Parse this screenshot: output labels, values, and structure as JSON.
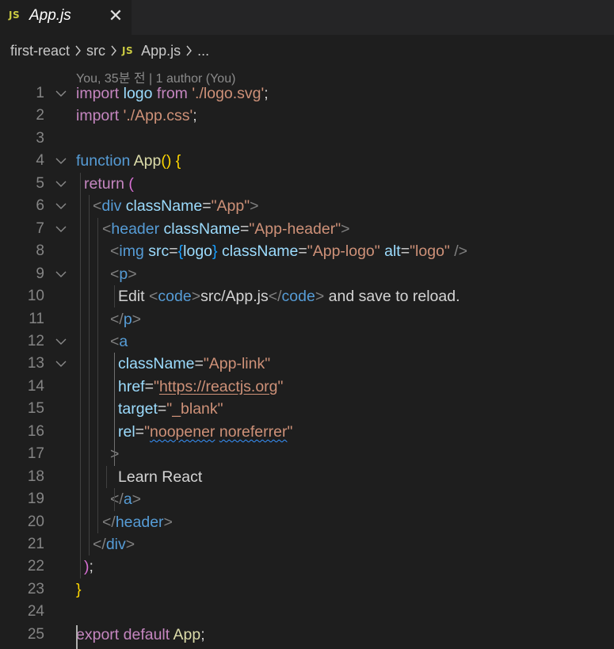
{
  "tab": {
    "badge": "JS",
    "title": "App.js",
    "close": "✕"
  },
  "breadcrumb": {
    "items": [
      "first-react",
      "src",
      "App.js",
      "..."
    ],
    "badge": "JS"
  },
  "blame": {
    "text": "You, 35분 전 | 1 author (You)"
  },
  "editor": {
    "lines": [
      {
        "n": "1",
        "fold": true,
        "tokens": [
          [
            "k",
            "import"
          ],
          [
            "p",
            " "
          ],
          [
            "v",
            "logo"
          ],
          [
            "p",
            " "
          ],
          [
            "k",
            "from"
          ],
          [
            "p",
            " "
          ],
          [
            "s",
            "'./logo.svg'"
          ],
          [
            "p",
            ";"
          ]
        ]
      },
      {
        "n": "2",
        "fold": false,
        "tokens": [
          [
            "k",
            "import"
          ],
          [
            "p",
            " "
          ],
          [
            "s",
            "'./App.css'"
          ],
          [
            "p",
            ";"
          ]
        ]
      },
      {
        "n": "3",
        "fold": false,
        "tokens": []
      },
      {
        "n": "4",
        "fold": true,
        "tokens": [
          [
            "kb",
            "function"
          ],
          [
            "p",
            " "
          ],
          [
            "f",
            "App"
          ],
          [
            "br1",
            "()"
          ],
          [
            "p",
            " "
          ],
          [
            "br1",
            "{"
          ]
        ]
      },
      {
        "n": "5",
        "fold": true,
        "tokens": [
          [
            "k",
            "return"
          ],
          [
            "p",
            " "
          ],
          [
            "br2",
            "("
          ]
        ]
      },
      {
        "n": "6",
        "fold": true,
        "tokens": [
          [
            "t",
            "<"
          ],
          [
            "tg",
            "div"
          ],
          [
            "p",
            " "
          ],
          [
            "v",
            "className"
          ],
          [
            "p",
            "="
          ],
          [
            "s",
            "\"App\""
          ],
          [
            "t",
            ">"
          ]
        ]
      },
      {
        "n": "7",
        "fold": true,
        "tokens": [
          [
            "t",
            "<"
          ],
          [
            "tg",
            "header"
          ],
          [
            "p",
            " "
          ],
          [
            "v",
            "className"
          ],
          [
            "p",
            "="
          ],
          [
            "s",
            "\"App-header\""
          ],
          [
            "t",
            ">"
          ]
        ]
      },
      {
        "n": "8",
        "fold": false,
        "tokens": [
          [
            "t",
            "<"
          ],
          [
            "tg",
            "img"
          ],
          [
            "p",
            " "
          ],
          [
            "v",
            "src"
          ],
          [
            "p",
            "="
          ],
          [
            "br3",
            "{"
          ],
          [
            "v",
            "logo"
          ],
          [
            "br3",
            "}"
          ],
          [
            "p",
            " "
          ],
          [
            "v",
            "className"
          ],
          [
            "p",
            "="
          ],
          [
            "s",
            "\"App-logo\""
          ],
          [
            "p",
            " "
          ],
          [
            "v",
            "alt"
          ],
          [
            "p",
            "="
          ],
          [
            "s",
            "\"logo\""
          ],
          [
            "p",
            " "
          ],
          [
            "t",
            "/>"
          ]
        ]
      },
      {
        "n": "9",
        "fold": true,
        "tokens": [
          [
            "t",
            "<"
          ],
          [
            "tg",
            "p"
          ],
          [
            "t",
            ">"
          ]
        ]
      },
      {
        "n": "10",
        "fold": false,
        "tokens": [
          [
            "p",
            "Edit "
          ],
          [
            "t",
            "<"
          ],
          [
            "tg",
            "code"
          ],
          [
            "t",
            ">"
          ],
          [
            "p",
            "src/App.js"
          ],
          [
            "t",
            "</"
          ],
          [
            "tg",
            "code"
          ],
          [
            "t",
            ">"
          ],
          [
            "p",
            " and save to reload."
          ]
        ]
      },
      {
        "n": "11",
        "fold": false,
        "tokens": [
          [
            "t",
            "</"
          ],
          [
            "tg",
            "p"
          ],
          [
            "t",
            ">"
          ]
        ]
      },
      {
        "n": "12",
        "fold": true,
        "tokens": [
          [
            "t",
            "<"
          ],
          [
            "tg",
            "a"
          ]
        ]
      },
      {
        "n": "13",
        "fold": true,
        "tokens": [
          [
            "v",
            "className"
          ],
          [
            "p",
            "="
          ],
          [
            "s",
            "\"App-link\""
          ]
        ]
      },
      {
        "n": "14",
        "fold": false,
        "tokens": [
          [
            "v",
            "href"
          ],
          [
            "p",
            "="
          ],
          [
            "s",
            "\""
          ],
          [
            "s u",
            "https://reactjs.org"
          ],
          [
            "s",
            "\""
          ]
        ]
      },
      {
        "n": "15",
        "fold": false,
        "tokens": [
          [
            "v",
            "target"
          ],
          [
            "p",
            "="
          ],
          [
            "s",
            "\"_blank\""
          ]
        ]
      },
      {
        "n": "16",
        "fold": false,
        "tokens": [
          [
            "v",
            "rel"
          ],
          [
            "p",
            "="
          ],
          [
            "s",
            "\""
          ],
          [
            "s sq",
            "noopener"
          ],
          [
            "s",
            " "
          ],
          [
            "s sq",
            "noreferrer"
          ],
          [
            "s",
            "\""
          ]
        ]
      },
      {
        "n": "17",
        "fold": false,
        "tokens": [
          [
            "t",
            ">"
          ]
        ]
      },
      {
        "n": "18",
        "fold": false,
        "tokens": [
          [
            "p",
            "Learn React"
          ]
        ]
      },
      {
        "n": "19",
        "fold": false,
        "tokens": [
          [
            "t",
            "</"
          ],
          [
            "tg",
            "a"
          ],
          [
            "t",
            ">"
          ]
        ]
      },
      {
        "n": "20",
        "fold": false,
        "tokens": [
          [
            "t",
            "</"
          ],
          [
            "tg",
            "header"
          ],
          [
            "t",
            ">"
          ]
        ]
      },
      {
        "n": "21",
        "fold": false,
        "tokens": [
          [
            "t",
            "</"
          ],
          [
            "tg",
            "div"
          ],
          [
            "t",
            ">"
          ]
        ]
      },
      {
        "n": "22",
        "fold": false,
        "tokens": [
          [
            "br2",
            ")"
          ],
          [
            "p",
            ";"
          ]
        ]
      },
      {
        "n": "23",
        "fold": false,
        "tokens": [
          [
            "br1",
            "}"
          ]
        ]
      },
      {
        "n": "24",
        "fold": false,
        "tokens": []
      },
      {
        "n": "25",
        "fold": false,
        "tokens": [
          [
            "k",
            "export"
          ],
          [
            "p",
            " "
          ],
          [
            "k",
            "default"
          ],
          [
            "p",
            " "
          ],
          [
            "f",
            "App"
          ],
          [
            "p",
            ";"
          ]
        ]
      }
    ]
  },
  "colors": {
    "background": "#1e1e1e",
    "keyword": "#c586c0",
    "storage": "#569cd6",
    "variable": "#9cdcfe",
    "function": "#dcdcaa",
    "string": "#ce9178",
    "js_badge": "#cbcb41"
  }
}
